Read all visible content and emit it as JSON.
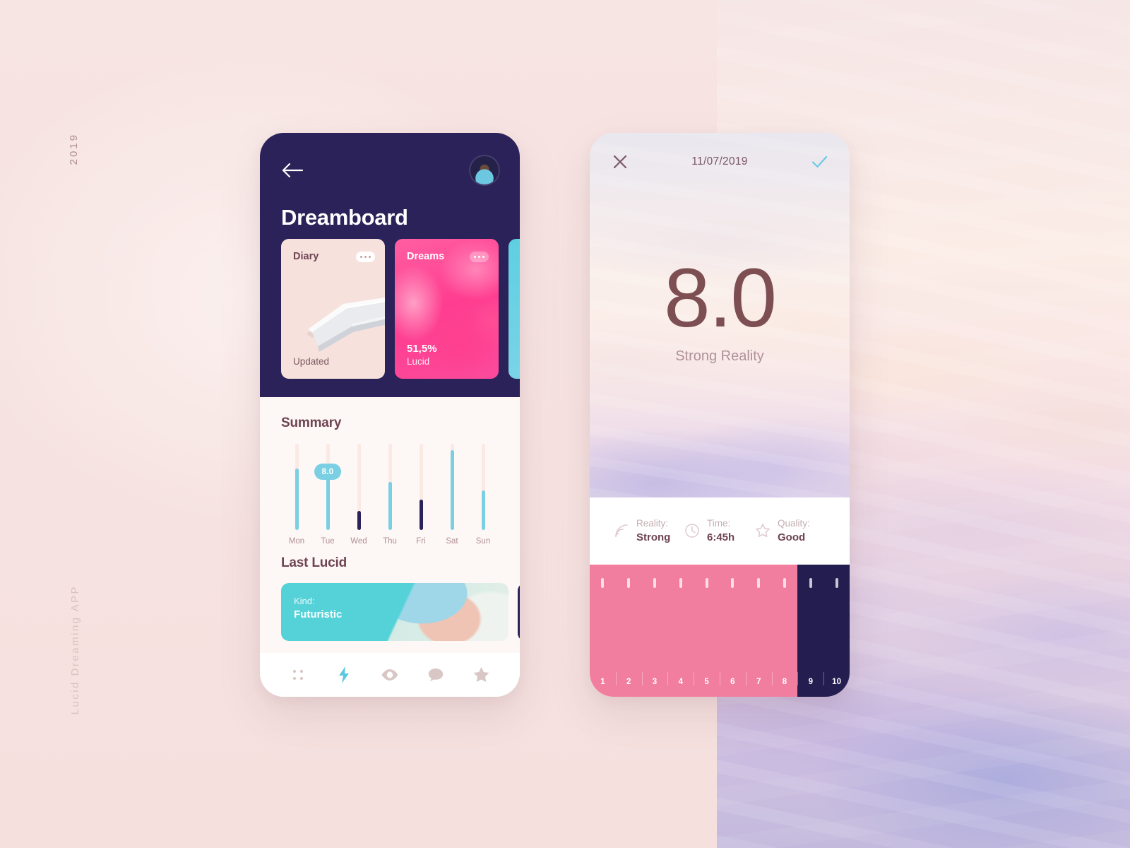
{
  "canvas": {
    "year_label": "2019",
    "app_label": "Lucid Dreaming APP"
  },
  "left_phone": {
    "back_icon": "back-arrow-icon",
    "avatar": "user-avatar",
    "title": "Dreamboard",
    "cards": [
      {
        "title": "Diary",
        "menu": "more-options-icon",
        "value": "",
        "sub": "Updated"
      },
      {
        "title": "Dreams",
        "menu": "more-options-icon",
        "value": "51,5%",
        "sub": "Lucid"
      }
    ],
    "summary_title": "Summary",
    "last_lucid_title": "Last Lucid",
    "last_lucid": {
      "kind_label": "Kind:",
      "kind_value": "Futuristic"
    },
    "nav": [
      {
        "icon": "grid-dots-icon",
        "active": false
      },
      {
        "icon": "lightning-bolt-icon",
        "active": true
      },
      {
        "icon": "eye-icon",
        "active": false
      },
      {
        "icon": "speech-bubble-icon",
        "active": false
      },
      {
        "icon": "star-icon",
        "active": false
      }
    ]
  },
  "right_phone": {
    "close_icon": "close-icon",
    "date": "11/07/2019",
    "confirm_icon": "checkmark-icon",
    "score": "8.0",
    "score_label": "Strong Reality",
    "stats": [
      {
        "icon": "signal-waves-icon",
        "key": "Reality:",
        "value": "Strong"
      },
      {
        "icon": "clock-icon",
        "key": "Time:",
        "value": "6:45h"
      },
      {
        "icon": "star-outline-icon",
        "key": "Quality:",
        "value": "Good"
      }
    ],
    "scale": {
      "values": [
        "1",
        "2",
        "3",
        "4",
        "5",
        "6",
        "7",
        "8",
        "9",
        "10"
      ],
      "selected": 8
    }
  },
  "colors": {
    "navy": "#2b2259",
    "navy_dark": "#241d4f",
    "pink_accent": "#ff3d90",
    "pink_scale": "#f27e9f",
    "teal": "#7ad0e2",
    "teal_card": "#54d2d8",
    "rose_text": "#6d4452",
    "muted_rose": "#b38f94",
    "bg_pink": "#f7e3e1"
  },
  "chart_data": {
    "type": "bar",
    "title": "Summary",
    "categories": [
      "Mon",
      "Tue",
      "Wed",
      "Thu",
      "Fri",
      "Sat",
      "Sun"
    ],
    "values": [
      7.1,
      8.0,
      2.2,
      5.6,
      3.5,
      9.3,
      4.6
    ],
    "ylim": [
      0,
      10
    ],
    "xlabel": "",
    "ylabel": "",
    "grid": false,
    "bars": [
      {
        "category": "Mon",
        "value": 7.1,
        "fill_pct": 71,
        "color": "#7ad0e2",
        "badge": null
      },
      {
        "category": "Tue",
        "value": 8.0,
        "fill_pct": 61,
        "color": "#7ad0e2",
        "badge": "8.0"
      },
      {
        "category": "Wed",
        "value": 2.2,
        "fill_pct": 22,
        "color": "#2b2259",
        "badge": null
      },
      {
        "category": "Thu",
        "value": 5.6,
        "fill_pct": 56,
        "color": "#7ad0e2",
        "badge": null
      },
      {
        "category": "Fri",
        "value": 3.5,
        "fill_pct": 35,
        "color": "#2b2259",
        "badge": null
      },
      {
        "category": "Sat",
        "value": 9.3,
        "fill_pct": 93,
        "color": "#7ad0e2",
        "badge": null
      },
      {
        "category": "Sun",
        "value": 4.6,
        "fill_pct": 46,
        "color": "#7ad0e2",
        "badge": null
      }
    ],
    "track_color": "#fbe9e4",
    "badge_value": "8.0"
  }
}
